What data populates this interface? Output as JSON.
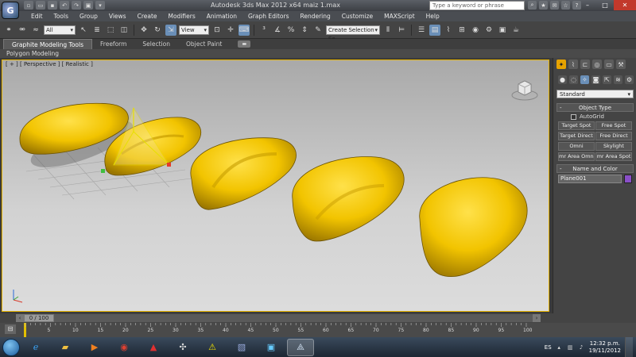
{
  "window": {
    "title": "Autodesk 3ds Max  2012 x64      maiz 1.max",
    "search_placeholder": "Type a keyword or phrase"
  },
  "menu": [
    "Edit",
    "Tools",
    "Group",
    "Views",
    "Create",
    "Modifiers",
    "Animation",
    "Graph Editors",
    "Rendering",
    "Customize",
    "MAXScript",
    "Help"
  ],
  "toolbar": {
    "filter_select": "All",
    "view_select": "View",
    "selection_set": "Create Selection Se"
  },
  "ribbon": {
    "tabs": [
      "Graphite Modeling Tools",
      "Freeform",
      "Selection",
      "Object Paint"
    ],
    "active_tab": "Graphite Modeling Tools",
    "subpanel": "Polygon Modeling"
  },
  "viewport": {
    "label": "[ + ] [ Perspective ] [ Realistic ]",
    "object_color": "#f2c400",
    "border_color": "#e7b400"
  },
  "command_panel": {
    "category": "Standard",
    "object_type_header": "Object Type",
    "autogrid": "AutoGrid",
    "buttons": [
      "Target Spot",
      "Free Spot",
      "Target Direct",
      "Free Direct",
      "Omni",
      "Skylight",
      "mr Area Omni",
      "mr Area Spot"
    ],
    "name_color_header": "Name and Color",
    "object_name": "Plane001",
    "object_color": "#8a4fc8"
  },
  "timeline": {
    "frame_display": "0 / 100",
    "ticks": [
      "5",
      "10",
      "15",
      "20",
      "25",
      "30",
      "35",
      "40",
      "45",
      "50",
      "55",
      "60",
      "65",
      "70",
      "75",
      "80",
      "85",
      "90",
      "95",
      "100"
    ]
  },
  "taskbar": {
    "language": "ES",
    "time": "12:32 p.m.",
    "date": "19/11/2012"
  }
}
